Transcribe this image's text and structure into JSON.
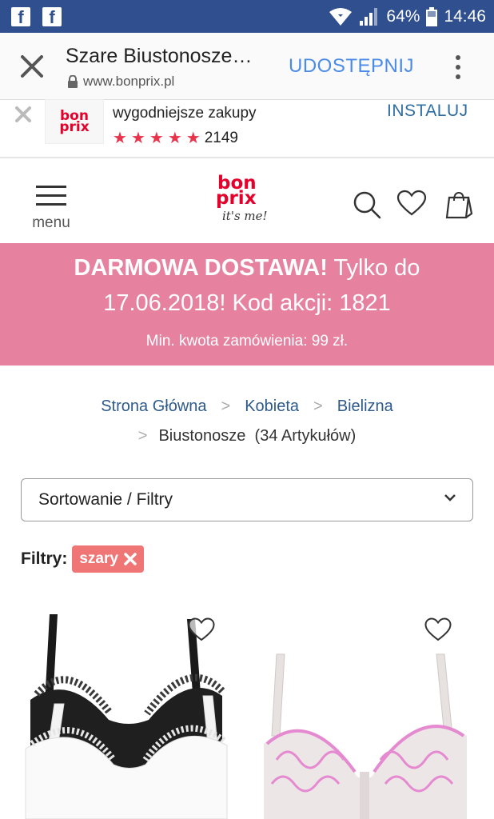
{
  "status_bar": {
    "battery": "64%",
    "time": "14:46"
  },
  "tab_bar": {
    "title": "Szare Biustonosze…",
    "url": "www.bonprix.pl",
    "share_label": "UDOSTĘPNIJ"
  },
  "app_banner": {
    "logo_line1": "bon",
    "logo_line2": "prix",
    "tagline": "wygodniejsze zakupy",
    "rating_count": "2149",
    "install_label": "INSTALUJ"
  },
  "header": {
    "menu_label": "menu",
    "logo_line1": "bon",
    "logo_line2": "prix",
    "logo_slogan": "it's me!"
  },
  "promo": {
    "bold_text": "DARMOWA DOSTAWA!",
    "text_part1": " Tylko do",
    "text_part2": "17.06.2018! Kod akcji: 1821",
    "min_text": "Min. kwota zamówienia: 99 zł."
  },
  "breadcrumb": {
    "items": [
      "Strona Główna",
      "Kobieta",
      "Bielizna"
    ],
    "current": "Biustonosze",
    "count": "(34 Artykułów)"
  },
  "sort": {
    "label": "Sortowanie / Filtry"
  },
  "filters": {
    "label": "Filtry:",
    "active": [
      "szary"
    ]
  },
  "colors": {
    "status_bar": "#2f4f8f",
    "share_blue": "#4a8be8",
    "brand_red": "#e4002b",
    "promo_pink": "#e6829f",
    "chip": "#f07575",
    "link": "#2e5a8c"
  }
}
